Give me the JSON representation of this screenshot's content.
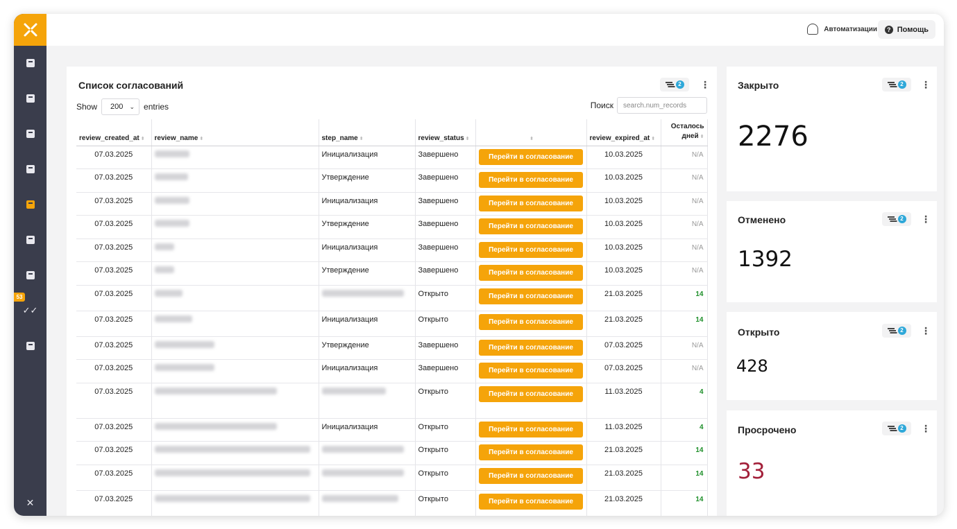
{
  "sidebar": {
    "logo": "brand-logo",
    "badge": "53",
    "items": [
      "people-icon",
      "clipboard-icon",
      "document-icon",
      "task-icon",
      "chart-icon",
      "question-icon",
      "report-icon",
      "check-icon",
      "expand-icon"
    ]
  },
  "topbar": {
    "automations_label": "Автоматизации",
    "help_label": "Помощь"
  },
  "main": {
    "title": "Список согласований",
    "filter_count": "2",
    "show_label": "Show",
    "entries_value": "200",
    "entries_label": "entries",
    "search_label": "Поиск",
    "search_placeholder": "search.num_records",
    "columns": [
      "review_created_at",
      "review_name",
      "step_name",
      "review_status",
      "",
      "review_expired_at",
      "Осталось дней"
    ],
    "button_label": "Перейти в согласование",
    "rows": [
      {
        "created": "07.03.2025",
        "step": "Инициализация",
        "status": "Завершено",
        "expired": "10.03.2025",
        "days": "N/A"
      },
      {
        "created": "07.03.2025",
        "step": "Утверждение",
        "status": "Завершено",
        "expired": "10.03.2025",
        "days": "N/A"
      },
      {
        "created": "07.03.2025",
        "step": "Инициализация",
        "status": "Завершено",
        "expired": "10.03.2025",
        "days": "N/A"
      },
      {
        "created": "07.03.2025",
        "step": "Утверждение",
        "status": "Завершено",
        "expired": "10.03.2025",
        "days": "N/A"
      },
      {
        "created": "07.03.2025",
        "step": "Инициализация",
        "status": "Завершено",
        "expired": "10.03.2025",
        "days": "N/A"
      },
      {
        "created": "07.03.2025",
        "step": "Утверждение",
        "status": "Завершено",
        "expired": "10.03.2025",
        "days": "N/A"
      },
      {
        "created": "07.03.2025",
        "step": "",
        "status": "Открыто",
        "expired": "21.03.2025",
        "days": "14"
      },
      {
        "created": "07.03.2025",
        "step": "Инициализация",
        "status": "Открыто",
        "expired": "21.03.2025",
        "days": "14"
      },
      {
        "created": "07.03.2025",
        "step": "Утверждение",
        "status": "Завершено",
        "expired": "07.03.2025",
        "days": "N/A"
      },
      {
        "created": "07.03.2025",
        "step": "Инициализация",
        "status": "Завершено",
        "expired": "07.03.2025",
        "days": "N/A"
      },
      {
        "created": "07.03.2025",
        "step": "",
        "status": "Открыто",
        "expired": "11.03.2025",
        "days": "4"
      },
      {
        "created": "07.03.2025",
        "step": "Инициализация",
        "status": "Открыто",
        "expired": "11.03.2025",
        "days": "4"
      },
      {
        "created": "07.03.2025",
        "step": "",
        "status": "Открыто",
        "expired": "21.03.2025",
        "days": "14"
      },
      {
        "created": "07.03.2025",
        "step": "",
        "status": "Открыто",
        "expired": "21.03.2025",
        "days": "14"
      },
      {
        "created": "07.03.2025",
        "step": "",
        "status": "Открыто",
        "expired": "21.03.2025",
        "days": "14"
      }
    ]
  },
  "stats": [
    {
      "title": "Закрыто",
      "value": "2276",
      "filter_count": "2",
      "color": "#111111"
    },
    {
      "title": "Отменено",
      "value": "1392",
      "filter_count": "2",
      "color": "#111111"
    },
    {
      "title": "Открыто",
      "value": "428",
      "filter_count": "2",
      "color": "#111111"
    },
    {
      "title": "Просрочено",
      "value": "33",
      "filter_count": "2",
      "color": "#a3203a"
    }
  ],
  "colors": {
    "accent": "#f5a40a",
    "sidebar": "#3a3d4c",
    "badge": "#2ea8d9",
    "positive": "#1e8f2a",
    "overdue": "#a3203a"
  }
}
